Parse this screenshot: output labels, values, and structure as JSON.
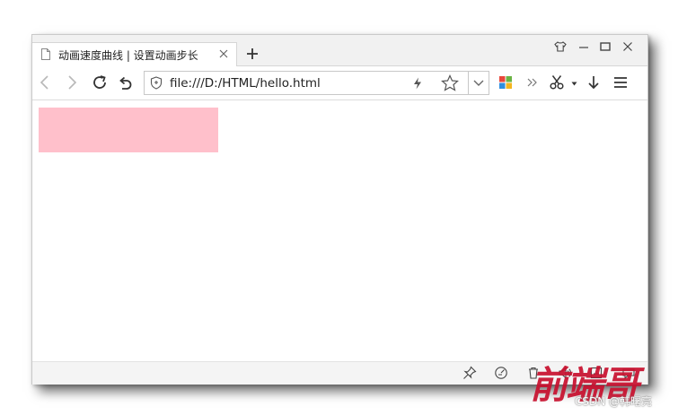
{
  "tab": {
    "title": "动画速度曲线 | 设置动画步长",
    "icon": "document-icon"
  },
  "window_controls": [
    "shirt-icon",
    "minimize-icon",
    "maximize-icon",
    "close-icon"
  ],
  "toolbar": {
    "address": "file:///D:/HTML/hello.html",
    "icons": [
      "back-icon",
      "forward-icon",
      "reload-icon",
      "undo-icon",
      "shield-icon",
      "lightning-icon",
      "star-icon",
      "chevron-down-icon",
      "apps-icon",
      "more-icon",
      "scissors-icon",
      "download-icon",
      "menu-icon"
    ]
  },
  "content": {
    "box_color": "#ffc0cb"
  },
  "colors": {
    "tabbar_bg": "#f1f1f1",
    "statusbar_bg": "#f4f4f4",
    "watermark_red": "#c8102e"
  },
  "watermark": {
    "credit": "CSDN @韩曙亮"
  }
}
